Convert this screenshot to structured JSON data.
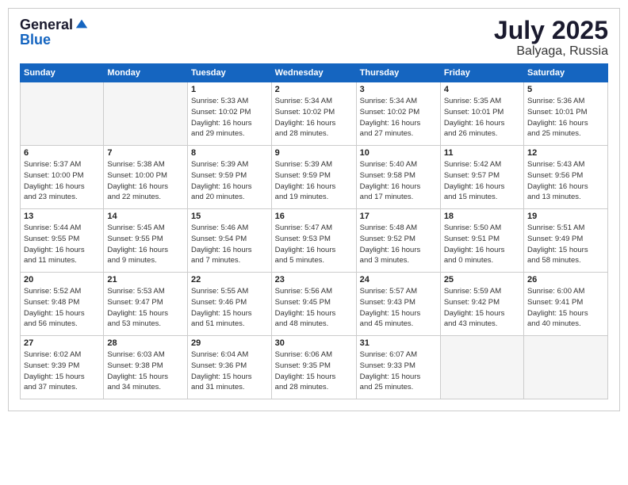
{
  "header": {
    "logo_general": "General",
    "logo_blue": "Blue",
    "month": "July 2025",
    "location": "Balyaga, Russia"
  },
  "weekdays": [
    "Sunday",
    "Monday",
    "Tuesday",
    "Wednesday",
    "Thursday",
    "Friday",
    "Saturday"
  ],
  "weeks": [
    [
      {
        "day": "",
        "info": ""
      },
      {
        "day": "",
        "info": ""
      },
      {
        "day": "1",
        "info": "Sunrise: 5:33 AM\nSunset: 10:02 PM\nDaylight: 16 hours\nand 29 minutes."
      },
      {
        "day": "2",
        "info": "Sunrise: 5:34 AM\nSunset: 10:02 PM\nDaylight: 16 hours\nand 28 minutes."
      },
      {
        "day": "3",
        "info": "Sunrise: 5:34 AM\nSunset: 10:02 PM\nDaylight: 16 hours\nand 27 minutes."
      },
      {
        "day": "4",
        "info": "Sunrise: 5:35 AM\nSunset: 10:01 PM\nDaylight: 16 hours\nand 26 minutes."
      },
      {
        "day": "5",
        "info": "Sunrise: 5:36 AM\nSunset: 10:01 PM\nDaylight: 16 hours\nand 25 minutes."
      }
    ],
    [
      {
        "day": "6",
        "info": "Sunrise: 5:37 AM\nSunset: 10:00 PM\nDaylight: 16 hours\nand 23 minutes."
      },
      {
        "day": "7",
        "info": "Sunrise: 5:38 AM\nSunset: 10:00 PM\nDaylight: 16 hours\nand 22 minutes."
      },
      {
        "day": "8",
        "info": "Sunrise: 5:39 AM\nSunset: 9:59 PM\nDaylight: 16 hours\nand 20 minutes."
      },
      {
        "day": "9",
        "info": "Sunrise: 5:39 AM\nSunset: 9:59 PM\nDaylight: 16 hours\nand 19 minutes."
      },
      {
        "day": "10",
        "info": "Sunrise: 5:40 AM\nSunset: 9:58 PM\nDaylight: 16 hours\nand 17 minutes."
      },
      {
        "day": "11",
        "info": "Sunrise: 5:42 AM\nSunset: 9:57 PM\nDaylight: 16 hours\nand 15 minutes."
      },
      {
        "day": "12",
        "info": "Sunrise: 5:43 AM\nSunset: 9:56 PM\nDaylight: 16 hours\nand 13 minutes."
      }
    ],
    [
      {
        "day": "13",
        "info": "Sunrise: 5:44 AM\nSunset: 9:55 PM\nDaylight: 16 hours\nand 11 minutes."
      },
      {
        "day": "14",
        "info": "Sunrise: 5:45 AM\nSunset: 9:55 PM\nDaylight: 16 hours\nand 9 minutes."
      },
      {
        "day": "15",
        "info": "Sunrise: 5:46 AM\nSunset: 9:54 PM\nDaylight: 16 hours\nand 7 minutes."
      },
      {
        "day": "16",
        "info": "Sunrise: 5:47 AM\nSunset: 9:53 PM\nDaylight: 16 hours\nand 5 minutes."
      },
      {
        "day": "17",
        "info": "Sunrise: 5:48 AM\nSunset: 9:52 PM\nDaylight: 16 hours\nand 3 minutes."
      },
      {
        "day": "18",
        "info": "Sunrise: 5:50 AM\nSunset: 9:51 PM\nDaylight: 16 hours\nand 0 minutes."
      },
      {
        "day": "19",
        "info": "Sunrise: 5:51 AM\nSunset: 9:49 PM\nDaylight: 15 hours\nand 58 minutes."
      }
    ],
    [
      {
        "day": "20",
        "info": "Sunrise: 5:52 AM\nSunset: 9:48 PM\nDaylight: 15 hours\nand 56 minutes."
      },
      {
        "day": "21",
        "info": "Sunrise: 5:53 AM\nSunset: 9:47 PM\nDaylight: 15 hours\nand 53 minutes."
      },
      {
        "day": "22",
        "info": "Sunrise: 5:55 AM\nSunset: 9:46 PM\nDaylight: 15 hours\nand 51 minutes."
      },
      {
        "day": "23",
        "info": "Sunrise: 5:56 AM\nSunset: 9:45 PM\nDaylight: 15 hours\nand 48 minutes."
      },
      {
        "day": "24",
        "info": "Sunrise: 5:57 AM\nSunset: 9:43 PM\nDaylight: 15 hours\nand 45 minutes."
      },
      {
        "day": "25",
        "info": "Sunrise: 5:59 AM\nSunset: 9:42 PM\nDaylight: 15 hours\nand 43 minutes."
      },
      {
        "day": "26",
        "info": "Sunrise: 6:00 AM\nSunset: 9:41 PM\nDaylight: 15 hours\nand 40 minutes."
      }
    ],
    [
      {
        "day": "27",
        "info": "Sunrise: 6:02 AM\nSunset: 9:39 PM\nDaylight: 15 hours\nand 37 minutes."
      },
      {
        "day": "28",
        "info": "Sunrise: 6:03 AM\nSunset: 9:38 PM\nDaylight: 15 hours\nand 34 minutes."
      },
      {
        "day": "29",
        "info": "Sunrise: 6:04 AM\nSunset: 9:36 PM\nDaylight: 15 hours\nand 31 minutes."
      },
      {
        "day": "30",
        "info": "Sunrise: 6:06 AM\nSunset: 9:35 PM\nDaylight: 15 hours\nand 28 minutes."
      },
      {
        "day": "31",
        "info": "Sunrise: 6:07 AM\nSunset: 9:33 PM\nDaylight: 15 hours\nand 25 minutes."
      },
      {
        "day": "",
        "info": ""
      },
      {
        "day": "",
        "info": ""
      }
    ]
  ]
}
